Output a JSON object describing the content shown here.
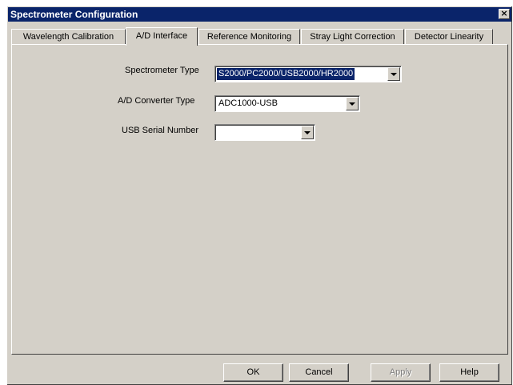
{
  "window": {
    "title": "Spectrometer Configuration",
    "close_label": "×"
  },
  "tabs": [
    {
      "label": "Wavelength Calibration",
      "active": false
    },
    {
      "label": "A/D Interface",
      "active": true
    },
    {
      "label": "Reference Monitoring",
      "active": false
    },
    {
      "label": "Stray Light Correction",
      "active": false
    },
    {
      "label": "Detector Linearity",
      "active": false
    }
  ],
  "form": {
    "spectrometer_type": {
      "label": "Spectrometer Type",
      "value": "S2000/PC2000/USB2000/HR2000"
    },
    "ad_converter_type": {
      "label": "A/D Converter Type",
      "value": "ADC1000-USB"
    },
    "usb_serial_number": {
      "label": "USB Serial Number",
      "value": ""
    }
  },
  "buttons": {
    "ok": "OK",
    "cancel": "Cancel",
    "apply": "Apply",
    "help": "Help"
  },
  "colors": {
    "titlebar": "#0a246a",
    "face": "#d4d0c8",
    "selection": "#0a246a"
  }
}
